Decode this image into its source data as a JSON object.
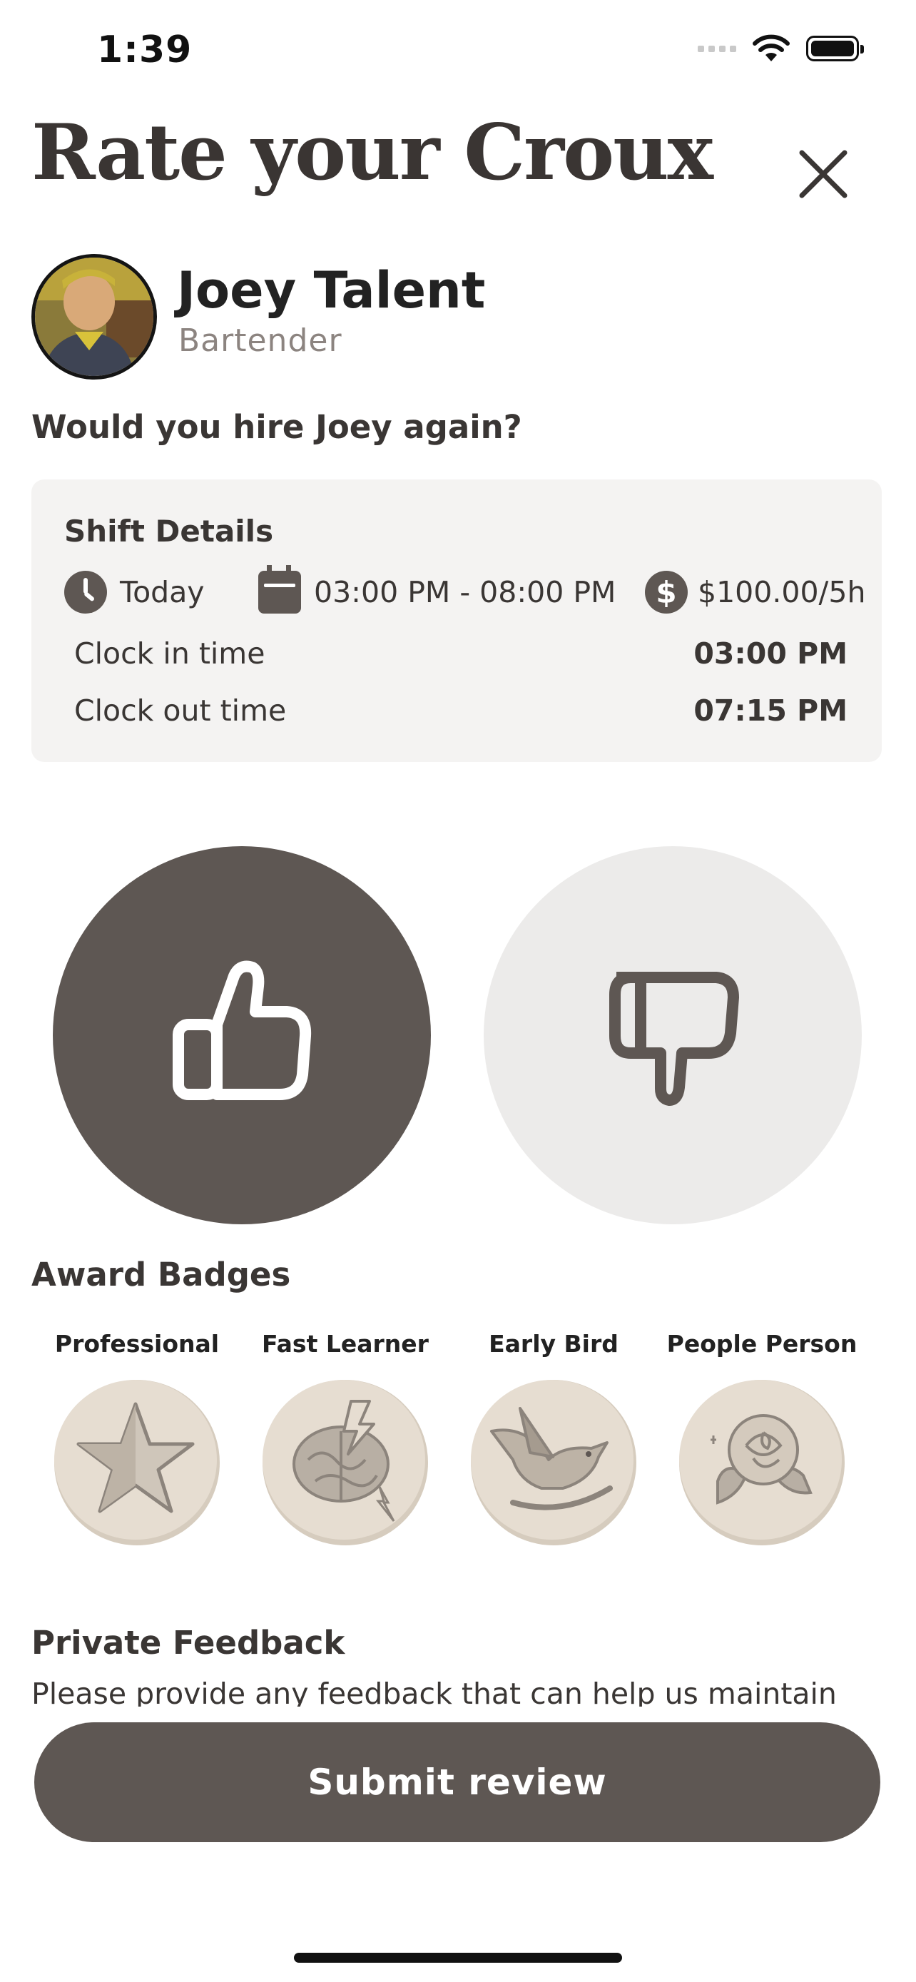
{
  "status_bar": {
    "time": "1:39"
  },
  "header": {
    "title": "Rate your Croux"
  },
  "profile": {
    "name": "Joey Talent",
    "role": "Bartender"
  },
  "question": "Would you hire Joey again?",
  "shift": {
    "title": "Shift Details",
    "date": "Today",
    "time_range": "03:00 PM - 08:00 PM",
    "pay": "$100.00/5h",
    "clock_in_label": "Clock in time",
    "clock_in_value": "03:00 PM",
    "clock_out_label": "Clock out time",
    "clock_out_value": "07:15 PM"
  },
  "rating": {
    "selected": "thumbs-up"
  },
  "badges": {
    "title": "Award Badges",
    "items": [
      {
        "label": "Professional",
        "icon": "star-icon"
      },
      {
        "label": "Fast Learner",
        "icon": "brain-icon"
      },
      {
        "label": "Early Bird",
        "icon": "bird-icon"
      },
      {
        "label": "People Person",
        "icon": "rose-icon"
      }
    ]
  },
  "feedback": {
    "title": "Private Feedback",
    "description": "Please provide any feedback that can help us maintain"
  },
  "submit_label": "Submit review",
  "colors": {
    "primary": "#5e5753",
    "muted": "#ecebea",
    "card": "#f4f3f2",
    "badge": "#e6ddd1"
  }
}
